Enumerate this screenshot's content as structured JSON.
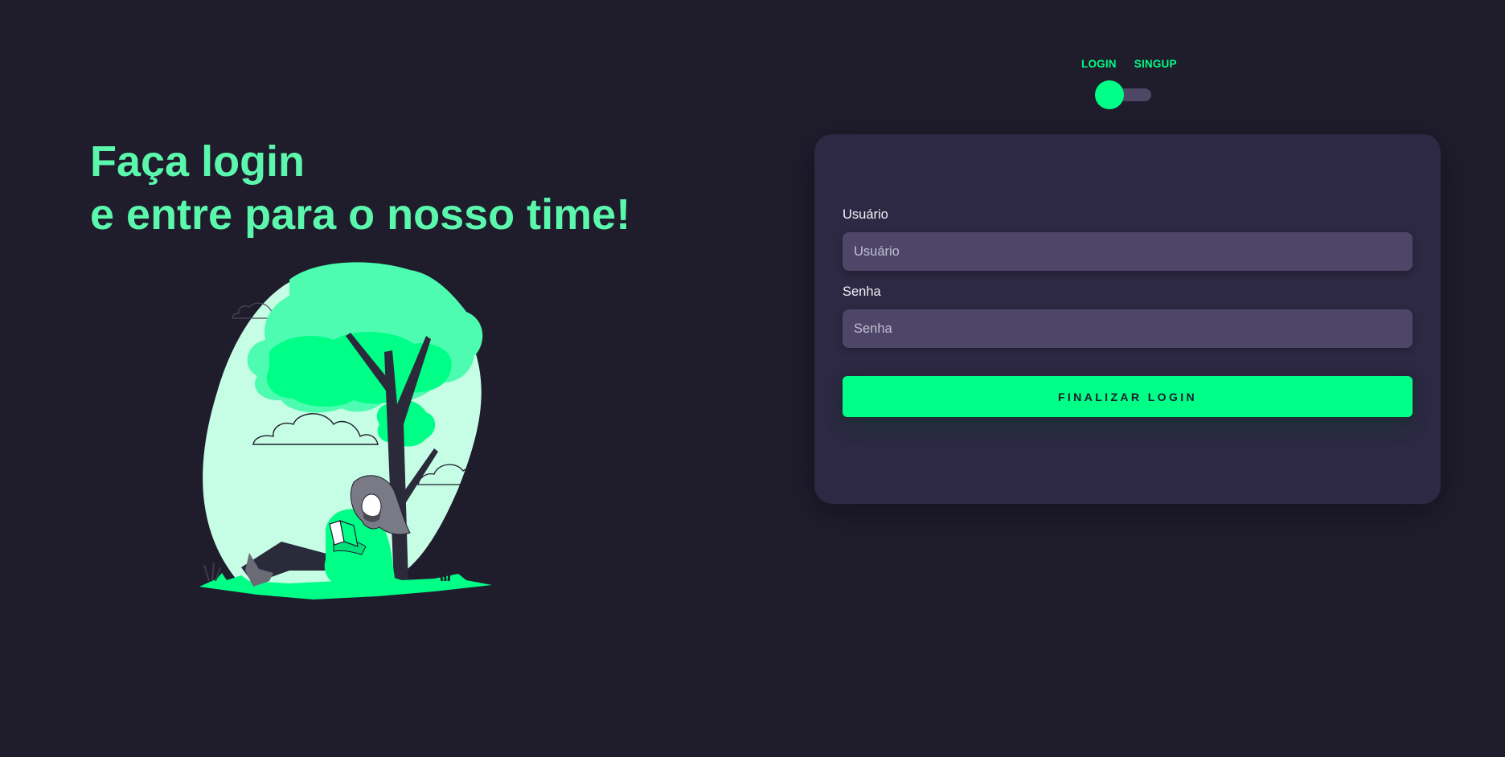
{
  "colors": {
    "background": "#1f1c2c",
    "accent": "#00ff87",
    "headline": "#5bf7ad",
    "card": "#2d2843",
    "input": "#4d4669"
  },
  "hero": {
    "headline_line1": "Faça login",
    "headline_line2": "e entre para o nosso time!"
  },
  "mode_switch": {
    "login_label": "LOGIN",
    "signup_label": "SINGUP",
    "active": "login"
  },
  "login_form": {
    "user_label": "Usuário",
    "user_placeholder": "Usuário",
    "user_value": "",
    "password_label": "Senha",
    "password_placeholder": "Senha",
    "password_value": "",
    "submit_label": "FINALIZAR LOGIN"
  },
  "illustration": {
    "icon": "reading-under-tree-illustration"
  }
}
